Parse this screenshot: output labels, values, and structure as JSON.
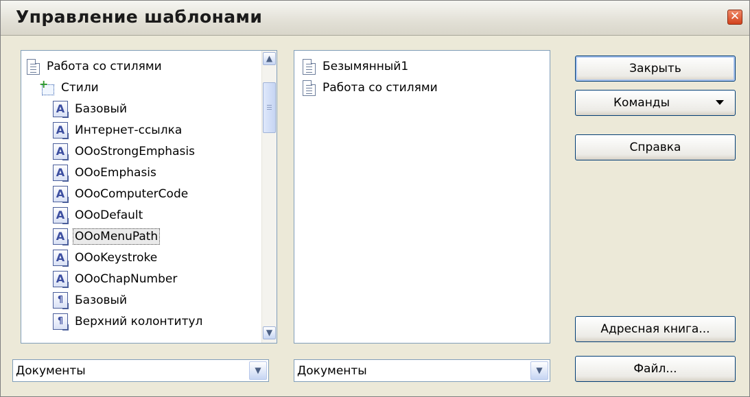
{
  "window": {
    "title": "Управление шаблонами",
    "close_glyph": "✕"
  },
  "templates_tree": {
    "items": [
      {
        "label": "Работа со стилями",
        "icon": "document-icon",
        "type": "doc"
      },
      {
        "label": "Стили",
        "icon": "styles-folder-icon",
        "type": "folder"
      },
      {
        "label": "Базовый",
        "icon": "character-style-icon",
        "type": "char"
      },
      {
        "label": "Интернет-ссылка",
        "icon": "character-style-icon",
        "type": "char"
      },
      {
        "label": "OOoStrongEmphasis",
        "icon": "character-style-icon",
        "type": "char"
      },
      {
        "label": "OOoEmphasis",
        "icon": "character-style-icon",
        "type": "char"
      },
      {
        "label": "OOoComputerCode",
        "icon": "character-style-icon",
        "type": "char"
      },
      {
        "label": "OOoDefault",
        "icon": "character-style-icon",
        "type": "char"
      },
      {
        "label": "OOoMenuPath",
        "icon": "character-style-icon",
        "type": "char",
        "selected": true
      },
      {
        "label": "OOoKeystroke",
        "icon": "character-style-icon",
        "type": "char"
      },
      {
        "label": "OOoChapNumber",
        "icon": "character-style-icon",
        "type": "char"
      },
      {
        "label": "Базовый",
        "icon": "paragraph-style-icon",
        "type": "para"
      },
      {
        "label": "Верхний колонтитул",
        "icon": "paragraph-style-icon",
        "type": "para"
      }
    ],
    "char_glyph": "A",
    "para_glyph": "¶",
    "scroll_up_glyph": "▲",
    "scroll_down_glyph": "▼"
  },
  "documents_list": {
    "items": [
      {
        "label": "Безымянный1",
        "icon": "document-icon"
      },
      {
        "label": "Работа со стилями",
        "icon": "document-icon"
      }
    ]
  },
  "buttons": {
    "close": "Закрыть",
    "commands": "Команды",
    "help": "Справка",
    "address_book": "Адресная книга...",
    "file": "Файл..."
  },
  "left_combo": {
    "value": "Документы",
    "arrow_glyph": "▼"
  },
  "right_combo": {
    "value": "Документы",
    "arrow_glyph": "▼"
  }
}
